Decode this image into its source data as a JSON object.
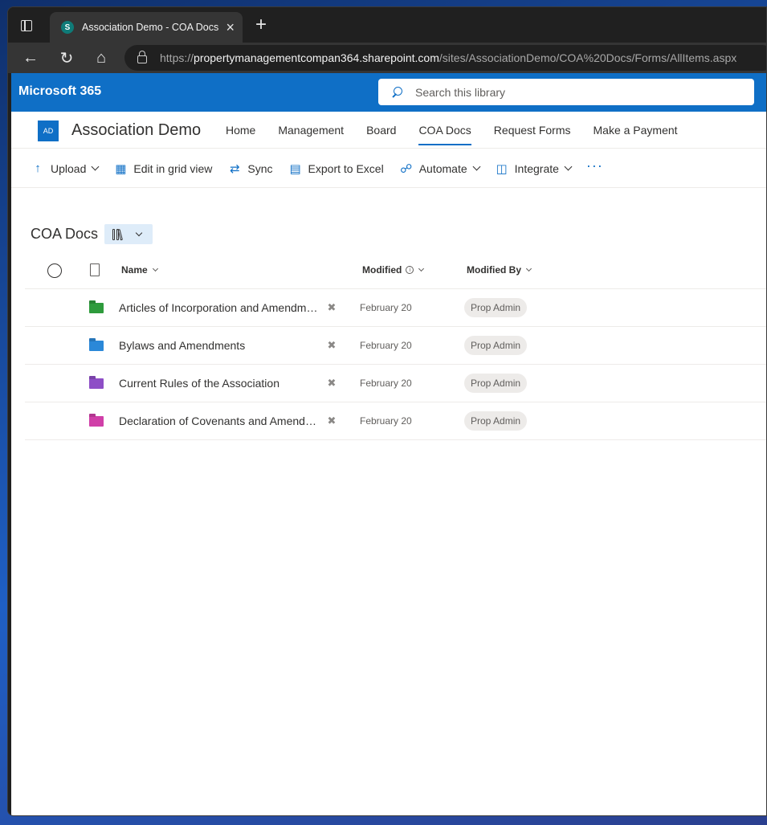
{
  "browser": {
    "tab_title": "Association Demo - COA Docs",
    "favicon_letter": "S",
    "url_prefix": "https://",
    "url_host": "propertymanagementcompan364.sharepoint.com",
    "url_path": "/sites/AssociationDemo/COA%20Docs/Forms/AllItems.aspx"
  },
  "suite": {
    "brand": "Microsoft 365",
    "search_placeholder": "Search this library"
  },
  "site": {
    "logo_initials": "AD",
    "title": "Association Demo",
    "nav": [
      {
        "label": "Home"
      },
      {
        "label": "Management"
      },
      {
        "label": "Board"
      },
      {
        "label": "COA Docs",
        "active": true
      },
      {
        "label": "Request Forms"
      },
      {
        "label": "Make a Payment"
      }
    ]
  },
  "commands": {
    "upload": "Upload",
    "grid": "Edit in grid view",
    "sync": "Sync",
    "export": "Export to Excel",
    "automate": "Automate",
    "integrate": "Integrate",
    "more": "···"
  },
  "library": {
    "title": "COA Docs",
    "columns": {
      "name": "Name",
      "modified": "Modified",
      "modified_by": "Modified By"
    },
    "items": [
      {
        "name": "Articles of Incorporation and Amendments",
        "modified": "February 20",
        "modified_by": "Prop Admin",
        "folder_color": "#2e9b3c"
      },
      {
        "name": "Bylaws and Amendments",
        "modified": "February 20",
        "modified_by": "Prop Admin",
        "folder_color": "#2b88d8"
      },
      {
        "name": "Current Rules of the Association",
        "modified": "February 20",
        "modified_by": "Prop Admin",
        "folder_color": "#8e4ec6"
      },
      {
        "name": "Declaration of Covenants and Amendments",
        "modified": "February 20",
        "modified_by": "Prop Admin",
        "folder_color": "#d03fa8"
      }
    ]
  },
  "colors": {
    "accent": "#0f6fc6",
    "browser_dark": "#202020"
  }
}
